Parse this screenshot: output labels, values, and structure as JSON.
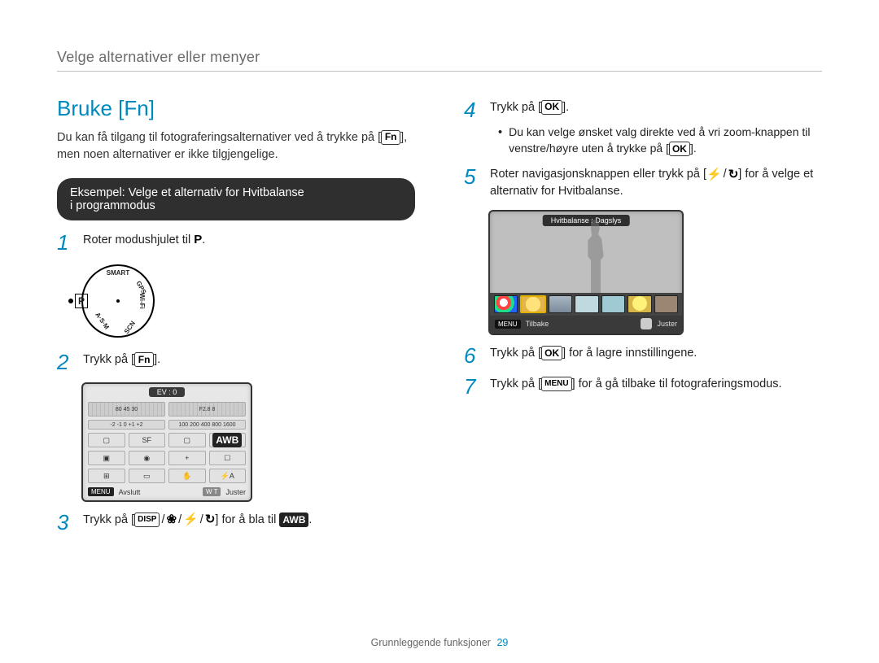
{
  "breadcrumb": "Velge alternativer eller menyer",
  "title": "Bruke [Fn]",
  "intro_before": "Du kan få tilgang til fotograferingsalternativer ved å trykke på [",
  "intro_fn": "Fn",
  "intro_after": "], men noen alternativer er ikke tilgjengelige.",
  "example_box_line1": "Eksempel: Velge et alternativ for Hvitbalanse",
  "example_box_line2": "i programmodus",
  "left_steps": {
    "s1_pre": "Roter modushjulet til ",
    "s1_icon": "P",
    "s1_post": ".",
    "s2_pre": "Trykk på [",
    "s2_icon": "Fn",
    "s2_post": "].",
    "s3_pre": "Trykk på [",
    "s3_i1": "DISP",
    "s3_i4": "] for å bla til ",
    "s3_awb": "AWB",
    "s3_end": "."
  },
  "dial_labels": {
    "top": "SMART",
    "right": "GPS",
    "right2": "Wi-Fi",
    "bottom": "SCN",
    "bottom2": "A·S·M",
    "left": "P"
  },
  "lcd1": {
    "ev": "EV : 0",
    "dial_left": "80   45   30",
    "dial_right": "F2.8   8",
    "slider_left": "-2   -1   0   +1   +2",
    "slider_right": "100  200  400  800 1600",
    "footer_menu": "MENU",
    "footer_left": "Avslutt",
    "footer_wt": "W   T",
    "footer_right": "Juster"
  },
  "right_steps": {
    "s4_pre": "Trykk på [",
    "s4_ok": "OK",
    "s4_post": "].",
    "s4_bullet_pre": "Du kan velge ønsket valg direkte ved å vri zoom-knappen til venstre/høyre uten å trykke på [",
    "s4_bullet_ok": "OK",
    "s4_bullet_post": "].",
    "s5_pre": "Roter navigasjonsknappen eller trykk på [",
    "s5_post": "] for å velge et alternativ for Hvitbalanse.",
    "s6_pre": "Trykk på [",
    "s6_ok": "OK",
    "s6_post": "] for å lagre innstillingene.",
    "s7_pre": "Trykk på [",
    "s7_menu": "MENU",
    "s7_post": "] for å gå tilbake til fotograferingsmodus."
  },
  "lcd2": {
    "banner": "Hvitbalanse : Dagslys",
    "footer_menu": "MENU",
    "footer_left": "Tilbake",
    "footer_right": "Juster"
  },
  "glyphs": {
    "macro": "❀",
    "timer": "↻",
    "slash": "/"
  },
  "page_footer_label": "Grunnleggende funksjoner",
  "page_number": "29"
}
